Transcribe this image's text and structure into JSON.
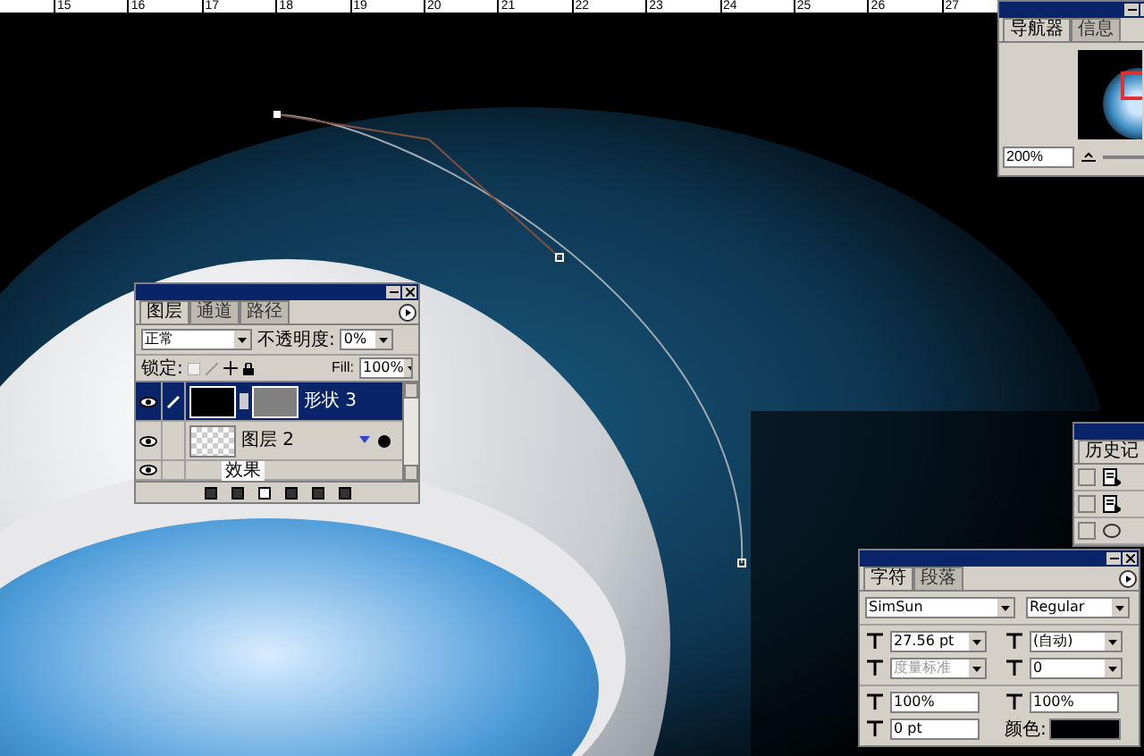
{
  "ruler": {
    "labels": [
      "15",
      "16",
      "17",
      "18",
      "19",
      "20",
      "21",
      "22",
      "23",
      "24",
      "25",
      "26",
      "27"
    ]
  },
  "navigator": {
    "tabs": [
      {
        "label": "导航器",
        "selected": true
      },
      {
        "label": "信息",
        "selected": false
      }
    ],
    "zoom": "200%"
  },
  "layers_panel": {
    "tabs": [
      {
        "label": "图层",
        "selected": true
      },
      {
        "label": "通道",
        "selected": false
      },
      {
        "label": "路径",
        "selected": false
      }
    ],
    "blend_mode": "正常",
    "opacity_label": "不透明度:",
    "opacity": "0%",
    "lock_label": "锁定:",
    "fill_label": "Fill:",
    "fill": "100%",
    "layers": [
      {
        "kind": "shape",
        "name": "形状 3",
        "selected": true,
        "visible": true
      },
      {
        "kind": "pixel",
        "name": "图层 2",
        "selected": false,
        "visible": true
      },
      {
        "kind": "effect",
        "name": "效果",
        "selected": false,
        "visible": true
      }
    ]
  },
  "history_panel": {
    "tabs": [
      {
        "label": "历史记",
        "selected": true
      }
    ],
    "items": [
      {
        "kind": "document"
      },
      {
        "kind": "document"
      },
      {
        "kind": "ellipse"
      }
    ]
  },
  "character_panel": {
    "tabs": [
      {
        "label": "字符",
        "selected": true
      },
      {
        "label": "段落",
        "selected": false
      }
    ],
    "font": "SimSun",
    "style": "Regular",
    "size": "27.56 pt",
    "leading": "(自动)",
    "kerning": "度量标准",
    "kerning_disabled": true,
    "tracking": "0",
    "vertical_scale": "100%",
    "horizontal_scale": "100%",
    "baseline": "0 pt",
    "color_label": "颜色:",
    "color": "#000000"
  }
}
